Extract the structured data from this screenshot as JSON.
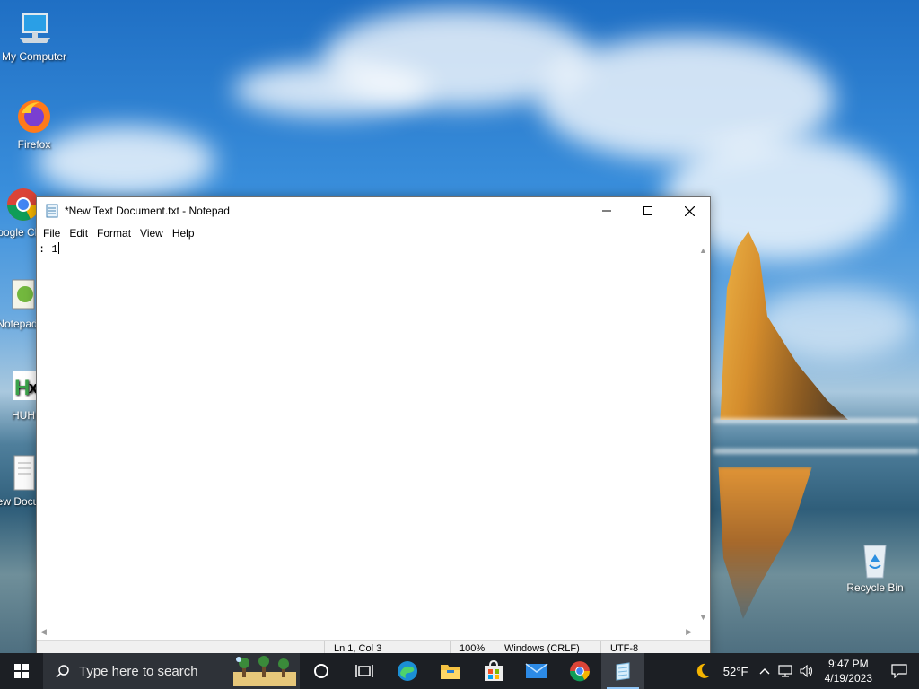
{
  "desktop": {
    "icons": [
      {
        "label": "My Computer",
        "icon": "computer-icon"
      },
      {
        "label": "Firefox",
        "icon": "firefox-icon"
      },
      {
        "label": "Google Chrome",
        "icon": "chrome-icon"
      },
      {
        "label": "Notepad++",
        "icon": "notepadpp-icon"
      },
      {
        "label": "HUH",
        "icon": "hx-icon"
      },
      {
        "label": "New Document",
        "icon": "text-file-icon"
      },
      {
        "label": "Recycle Bin",
        "icon": "recycle-bin-icon"
      }
    ]
  },
  "notepad": {
    "title": "*New Text Document.txt - Notepad",
    "menu": [
      "File",
      "Edit",
      "Format",
      "View",
      "Help"
    ],
    "content": ": 1",
    "status": {
      "position": "Ln 1, Col 3",
      "zoom": "100%",
      "line_ending": "Windows (CRLF)",
      "encoding": "UTF-8"
    }
  },
  "taskbar": {
    "search_placeholder": "Type here to search",
    "apps": [
      "cortana-icon",
      "task-view-icon",
      "edge-icon",
      "file-explorer-icon",
      "store-icon",
      "mail-icon",
      "chrome-icon",
      "notepad-icon"
    ],
    "weather": "52°F",
    "time": "9:47 PM",
    "date": "4/19/2023"
  }
}
